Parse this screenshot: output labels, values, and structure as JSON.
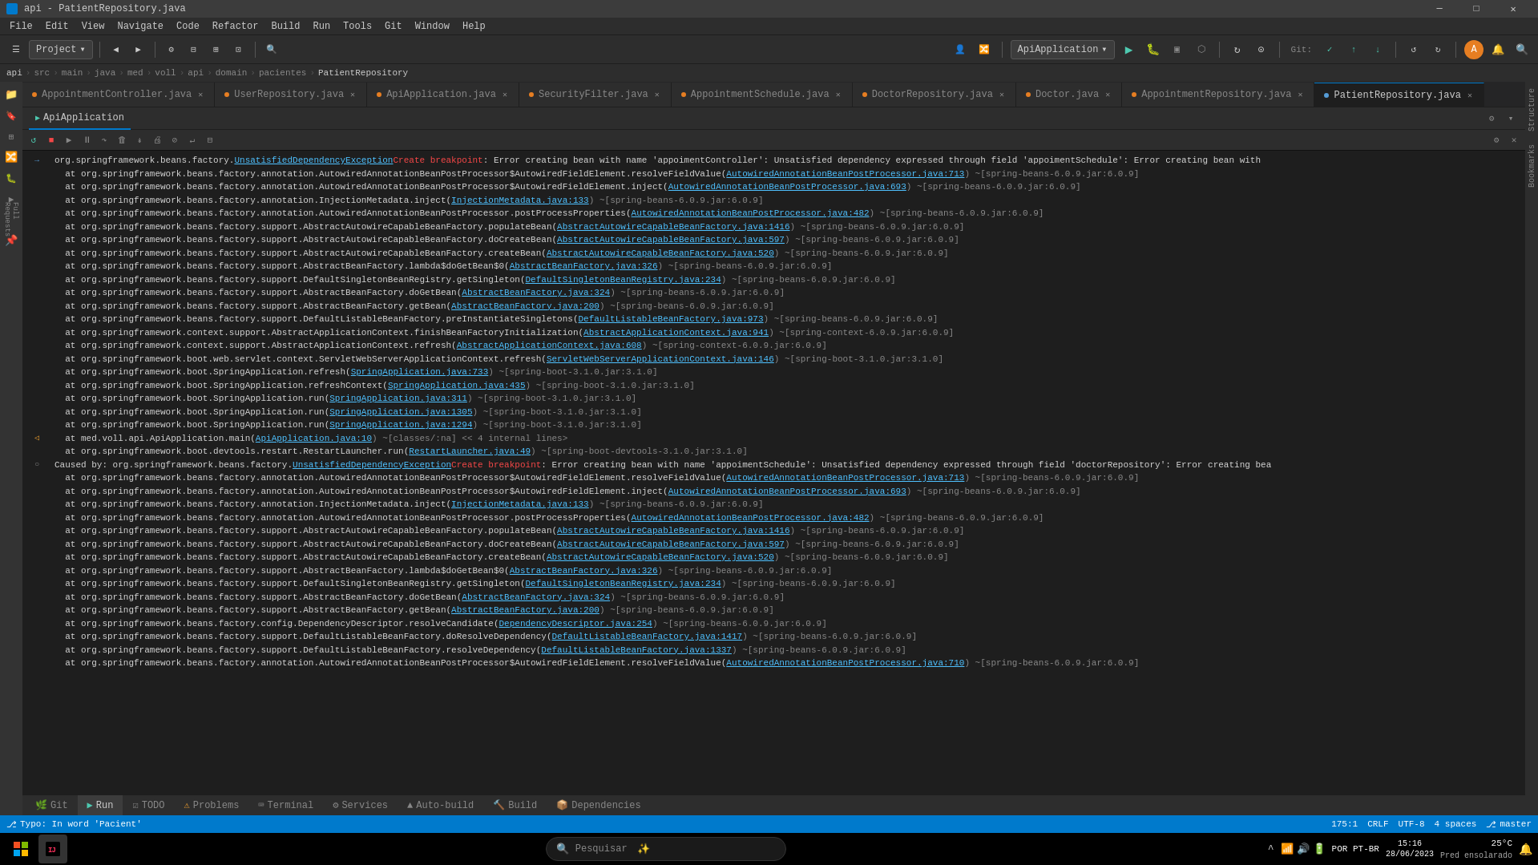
{
  "titlebar": {
    "title": "api - PatientRepository.java",
    "minimize": "—",
    "maximize": "□",
    "close": "✕"
  },
  "menubar": {
    "items": [
      "File",
      "Edit",
      "View",
      "Navigate",
      "Code",
      "Refactor",
      "Build",
      "Run",
      "Tools",
      "Git",
      "Window",
      "Help"
    ]
  },
  "breadcrumb": {
    "items": [
      "api",
      "src",
      "main",
      "java",
      "med",
      "voll",
      "api",
      "domain",
      "pacientes",
      "PatientRepository"
    ]
  },
  "toolbar": {
    "project_label": "Project",
    "run_config": "ApiApplication",
    "git_label": "Git:"
  },
  "tabs": [
    {
      "label": "AppointmentController.java",
      "active": false
    },
    {
      "label": "UserRepository.java",
      "active": false
    },
    {
      "label": "ApiApplication.java",
      "active": false
    },
    {
      "label": "SecurityFilter.java",
      "active": false
    },
    {
      "label": "AppointmentSchedule.java",
      "active": false
    },
    {
      "label": "DoctorRepository.java",
      "active": false
    },
    {
      "label": "Doctor.java",
      "active": false
    },
    {
      "label": "AppointmentRepository.java",
      "active": false
    },
    {
      "label": "PatientRepository.java",
      "active": true
    }
  ],
  "run_panel": {
    "tab_label": "Run",
    "config_label": "ApiApplication"
  },
  "console_lines": [
    {
      "indent": 0,
      "gutter": "arrow",
      "text": "org.springframework.beans.factory.UnsatisfiedDependencyException",
      "suffix": " Create breakpoint : Error creating bean with name 'appoimentController': Unsatisfied dependency expressed through field 'appoimentSchedule': Error creating bean with",
      "type": "error_link"
    },
    {
      "indent": 1,
      "text": "at org.springframework.beans.factory.annotation.AutowiredAnnotationBeanPostProcessor$AutowiredFieldElement.resolveFieldValue(",
      "link": "AutowiredAnnotationBeanPostProcessor.java:713",
      "suffix": ") ~[spring-beans-6.0.9.jar:6.0.9]"
    },
    {
      "indent": 1,
      "text": "at org.springframework.beans.factory.annotation.AutowiredAnnotationBeanPostProcessor$AutowiredFieldElement.inject(",
      "link": "AutowiredAnnotationBeanPostProcessor.java:693",
      "suffix": ") ~[spring-beans-6.0.9.jar:6.0.9]"
    },
    {
      "indent": 1,
      "text": "at org.springframework.beans.factory.annotation.InjectionMetadata.inject(",
      "link": "InjectionMetadata.java:133",
      "suffix": ") ~[spring-beans-6.0.9.jar:6.0.9]"
    },
    {
      "indent": 1,
      "text": "at org.springframework.beans.factory.annotation.AutowiredAnnotationBeanPostProcessor.postProcessProperties(",
      "link": "AutowiredAnnotationBeanPostProcessor.java:482",
      "suffix": ") ~[spring-beans-6.0.9.jar:6.0.9]"
    },
    {
      "indent": 1,
      "text": "at org.springframework.beans.factory.support.AbstractAutowireCapableBeanFactory.populateBean(",
      "link": "AbstractAutowireCapableBeanFactory.java:1416",
      "suffix": ") ~[spring-beans-6.0.9.jar:6.0.9]"
    },
    {
      "indent": 1,
      "text": "at org.springframework.beans.factory.support.AbstractAutowireCapableBeanFactory.doCreateBean(",
      "link": "AbstractAutowireCapableBeanFactory.java:597",
      "suffix": ") ~[spring-beans-6.0.9.jar:6.0.9]"
    },
    {
      "indent": 1,
      "text": "at org.springframework.beans.factory.support.AbstractAutowireCapableBeanFactory.createBean(",
      "link": "AbstractAutowireCapableBeanFactory.java:520",
      "suffix": ") ~[spring-beans-6.0.9.jar:6.0.9]"
    },
    {
      "indent": 1,
      "text": "at org.springframework.beans.factory.support.AbstractBeanFactory.lambda$doGetBean$0(",
      "link": "AbstractBeanFactory.java:326",
      "suffix": ") ~[spring-beans-6.0.9.jar:6.0.9]"
    },
    {
      "indent": 1,
      "text": "at org.springframework.beans.factory.support.DefaultSingletonBeanRegistry.getSingleton(",
      "link": "DefaultSingletonBeanRegistry.java:234",
      "suffix": ") ~[spring-beans-6.0.9.jar:6.0.9]"
    },
    {
      "indent": 1,
      "text": "at org.springframework.beans.factory.support.AbstractBeanFactory.doGetBean(",
      "link": "AbstractBeanFactory.java:324",
      "suffix": ") ~[spring-beans-6.0.9.jar:6.0.9]"
    },
    {
      "indent": 1,
      "text": "at org.springframework.beans.factory.support.AbstractBeanFactory.getBean(",
      "link": "AbstractBeanFactory.java:200",
      "suffix": ") ~[spring-beans-6.0.9.jar:6.0.9]"
    },
    {
      "indent": 1,
      "text": "at org.springframework.beans.factory.support.DefaultListableBeanFactory.preInstantiateSingletons(",
      "link": "DefaultListableBeanFactory.java:973",
      "suffix": ") ~[spring-beans-6.0.9.jar:6.0.9]"
    },
    {
      "indent": 1,
      "text": "at org.springframework.context.support.AbstractApplicationContext.finishBeanFactoryInitialization(",
      "link": "AbstractApplicationContext.java:941",
      "suffix": ") ~[spring-context-6.0.9.jar:6.0.9]"
    },
    {
      "indent": 1,
      "text": "at org.springframework.context.support.AbstractApplicationContext.refresh(",
      "link": "AbstractApplicationContext.java:608",
      "suffix": ") ~[spring-context-6.0.9.jar:6.0.9]"
    },
    {
      "indent": 1,
      "text": "at org.springframework.boot.web.servlet.context.ServletWebServerApplicationContext.refresh(",
      "link": "ServletWebServerApplicationContext.java:146",
      "suffix": ") ~[spring-boot-3.1.0.jar:3.1.0]"
    },
    {
      "indent": 1,
      "text": "at org.springframework.boot.SpringApplication.refresh(",
      "link": "SpringApplication.java:733",
      "suffix": ") ~[spring-boot-3.1.0.jar:3.1.0]"
    },
    {
      "indent": 1,
      "text": "at org.springframework.boot.SpringApplication.refreshContext(",
      "link": "SpringApplication.java:435",
      "suffix": ") ~[spring-boot-3.1.0.jar:3.1.0]"
    },
    {
      "indent": 1,
      "text": "at org.springframework.boot.SpringApplication.run(",
      "link": "SpringApplication.java:311",
      "suffix": ") ~[spring-boot-3.1.0.jar:3.1.0]"
    },
    {
      "indent": 1,
      "text": "at org.springframework.boot.SpringApplication.run(",
      "link": "SpringApplication.java:1305",
      "suffix": ") ~[spring-boot-3.1.0.jar:3.1.0]"
    },
    {
      "indent": 1,
      "text": "at org.springframework.boot.SpringApplication.run(",
      "link": "SpringApplication.java:1294",
      "suffix": ") ~[spring-boot-3.1.0.jar:3.1.0]"
    },
    {
      "indent": 1,
      "text": "at med.voll.api.ApiApplication.main(",
      "link": "ApiApplication.java:10",
      "suffix": ") ~[classes/:na]  << 4 internal lines>"
    },
    {
      "indent": 1,
      "text": "at org.springframework.boot.devtools.restart.RestartLauncher.run(",
      "link": "RestartLauncher.java:49",
      "suffix": ") ~[spring-boot-devtools-3.1.0.jar:3.1.0]"
    },
    {
      "indent": 0,
      "gutter": "circle",
      "text": "Caused by: org.springframework.beans.factory.UnsatisfiedDependencyException",
      "suffix": " Create breakpoint : Error creating bean with name 'appoimentSchedule': Unsatisfied dependency expressed through field 'doctorRepository': Error creating bea",
      "type": "caused_link"
    },
    {
      "indent": 1,
      "text": "at org.springframework.beans.factory.annotation.AutowiredAnnotationBeanPostProcessor$AutowiredFieldElement.resolveFieldValue(",
      "link": "AutowiredAnnotationBeanPostProcessor.java:713",
      "suffix": ") ~[spring-beans-6.0.9.jar:6.0.9]"
    },
    {
      "indent": 1,
      "text": "at org.springframework.beans.factory.annotation.AutowiredAnnotationBeanPostProcessor$AutowiredFieldElement.inject(",
      "link": "AutowiredAnnotationBeanPostProcessor.java:693",
      "suffix": ") ~[spring-beans-6.0.9.jar:6.0.9]"
    },
    {
      "indent": 1,
      "text": "at org.springframework.beans.factory.annotation.InjectionMetadata.inject(",
      "link": "InjectionMetadata.java:133",
      "suffix": ") ~[spring-beans-6.0.9.jar:6.0.9]"
    },
    {
      "indent": 1,
      "text": "at org.springframework.beans.factory.annotation.AutowiredAnnotationBeanPostProcessor.postProcessProperties(",
      "link": "AutowiredAnnotationBeanPostProcessor.java:482",
      "suffix": ") ~[spring-beans-6.0.9.jar:6.0.9]"
    },
    {
      "indent": 1,
      "text": "at org.springframework.beans.factory.support.AbstractAutowireCapableBeanFactory.populateBean(",
      "link": "AbstractAutowireCapableBeanFactory.java:1416",
      "suffix": ") ~[spring-beans-6.0.9.jar:6.0.9]"
    },
    {
      "indent": 1,
      "text": "at org.springframework.beans.factory.support.AbstractAutowireCapableBeanFactory.doCreateBean(",
      "link": "AbstractAutowireCapableBeanFactory.java:597",
      "suffix": ") ~[spring-beans-6.0.9.jar:6.0.9]"
    },
    {
      "indent": 1,
      "text": "at org.springframework.beans.factory.support.AbstractAutowireCapableBeanFactory.createBean(",
      "link": "AbstractAutowireCapableBeanFactory.java:520",
      "suffix": ") ~[spring-beans-6.0.9.jar:6.0.9]"
    },
    {
      "indent": 1,
      "text": "at org.springframework.beans.factory.support.AbstractBeanFactory.lambda$doGetBean$0(",
      "link": "AbstractBeanFactory.java:326",
      "suffix": ") ~[spring-beans-6.0.9.jar:6.0.9]"
    },
    {
      "indent": 1,
      "text": "at org.springframework.beans.factory.support.DefaultSingletonBeanRegistry.getSingleton(",
      "link": "DefaultSingletonBeanRegistry.java:234",
      "suffix": ") ~[spring-beans-6.0.9.jar:6.0.9]"
    },
    {
      "indent": 1,
      "text": "at org.springframework.beans.factory.support.AbstractBeanFactory.doGetBean(",
      "link": "AbstractBeanFactory.java:324",
      "suffix": ") ~[spring-beans-6.0.9.jar:6.0.9]"
    },
    {
      "indent": 1,
      "text": "at org.springframework.beans.factory.support.AbstractBeanFactory.getBean(",
      "link": "AbstractBeanFactory.java:200",
      "suffix": ") ~[spring-beans-6.0.9.jar:6.0.9]"
    },
    {
      "indent": 1,
      "text": "at org.springframework.beans.factory.config.DependencyDescriptor.resolveCandidate(",
      "link": "DependencyDescriptor.java:254",
      "suffix": ") ~[spring-beans-6.0.9.jar:6.0.9]"
    },
    {
      "indent": 1,
      "text": "at org.springframework.beans.factory.support.DefaultListableBeanFactory.doResolveDependency(",
      "link": "DefaultListableBeanFactory.java:1417",
      "suffix": ") ~[spring-beans-6.0.9.jar:6.0.9]"
    },
    {
      "indent": 1,
      "text": "at org.springframework.beans.factory.support.DefaultListableBeanFactory.resolveDependency(",
      "link": "DefaultListableBeanFactory.java:1337",
      "suffix": ") ~[spring-beans-6.0.9.jar:6.0.9]"
    },
    {
      "indent": 1,
      "text": "at org.springframework.beans.factory.annotation.AutowiredAnnotationBeanPostProcessor$AutowiredFieldElement.resolveFieldValue(",
      "link": "AutowiredAnnotationBeanPostProcessor.java:710",
      "suffix": ") ~[spring-beans-6.0.9.jar:6.0.9]"
    }
  ],
  "bottom_tabs": [
    {
      "label": "Git",
      "icon": "🌿"
    },
    {
      "label": "Run",
      "icon": "▶",
      "active": true
    },
    {
      "label": "TODO",
      "icon": "☑"
    },
    {
      "label": "Problems",
      "icon": "⚠"
    },
    {
      "label": "Terminal",
      "icon": ">_"
    },
    {
      "label": "Services",
      "icon": "⚙"
    },
    {
      "label": "Auto-build",
      "icon": "🔨"
    },
    {
      "label": "Build",
      "icon": "🔧"
    },
    {
      "label": "Dependencies",
      "icon": "📦"
    }
  ],
  "statusbar": {
    "typo": "Typo: In word 'Pacient'",
    "line_col": "175:1",
    "crlf": "CRLF",
    "encoding": "UTF-8",
    "indent": "4 spaces",
    "branch": "master"
  },
  "taskbar": {
    "search_placeholder": "Pesquisar",
    "time": "15:16",
    "date": "28/06/2023",
    "lang": "POR PT-BR",
    "temp": "25°C",
    "weather": "Pred ensolarado"
  },
  "sidebar_icons": [
    "📁",
    "🔍",
    "⚙",
    "🔀",
    "🐛",
    "📌",
    "◀"
  ],
  "right_sidebar": {
    "labels": [
      "Structure",
      "Bookmarks"
    ]
  }
}
